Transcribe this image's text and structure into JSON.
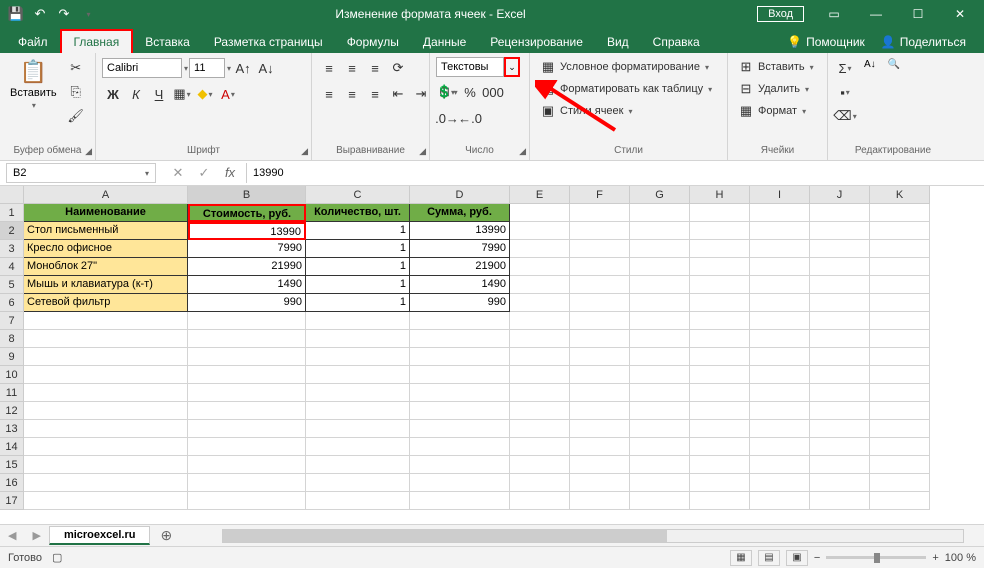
{
  "title": "Изменение формата ячеек  -  Excel",
  "login": "Вход",
  "tabs": {
    "file": "Файл",
    "home": "Главная",
    "insert": "Вставка",
    "layout": "Разметка страницы",
    "formulas": "Формулы",
    "data": "Данные",
    "review": "Рецензирование",
    "view": "Вид",
    "help": "Справка",
    "assistant": "Помощник",
    "share": "Поделиться"
  },
  "ribbon": {
    "clipboard": {
      "paste": "Вставить",
      "label": "Буфер обмена"
    },
    "font": {
      "name": "Calibri",
      "size": "11",
      "label": "Шрифт"
    },
    "alignment": {
      "label": "Выравнивание"
    },
    "number": {
      "format": "Текстовы",
      "label": "Число"
    },
    "styles": {
      "conditional": "Условное форматирование",
      "table": "Форматировать как таблицу",
      "cell": "Стили ячеек",
      "label": "Стили"
    },
    "cells": {
      "insert": "Вставить",
      "delete": "Удалить",
      "format": "Формат",
      "label": "Ячейки"
    },
    "editing": {
      "label": "Редактирование"
    }
  },
  "formula_bar": {
    "cell_ref": "B2",
    "value": "13990"
  },
  "columns": [
    "A",
    "B",
    "C",
    "D",
    "E",
    "F",
    "G",
    "H",
    "I",
    "J",
    "K"
  ],
  "headers": {
    "name": "Наименование",
    "cost": "Стоимость, руб.",
    "qty": "Количество, шт.",
    "sum": "Сумма, руб."
  },
  "rows": [
    {
      "name": "Стол письменный",
      "cost": "13990",
      "qty": "1",
      "sum": "13990"
    },
    {
      "name": "Кресло офисное",
      "cost": "7990",
      "qty": "1",
      "sum": "7990"
    },
    {
      "name": "Моноблок 27\"",
      "cost": "21990",
      "qty": "1",
      "sum": "21900"
    },
    {
      "name": "Мышь и клавиатура (к-т)",
      "cost": "1490",
      "qty": "1",
      "sum": "1490"
    },
    {
      "name": "Сетевой фильтр",
      "cost": "990",
      "qty": "1",
      "sum": "990"
    }
  ],
  "sheet_tab": "microexcel.ru",
  "status": {
    "ready": "Готово",
    "zoom": "100 %"
  }
}
